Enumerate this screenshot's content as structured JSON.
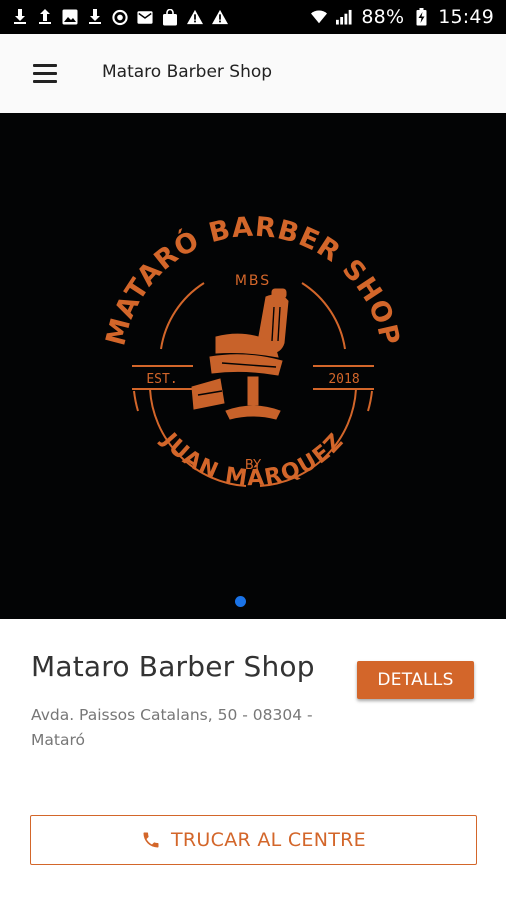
{
  "status_bar": {
    "left_icons": [
      "download-icon",
      "upload-icon",
      "image-icon",
      "download-icon",
      "sync-icon",
      "mail-icon",
      "bag-icon",
      "warning-icon",
      "warning-icon"
    ],
    "battery_percent": "88%",
    "time": "15:49"
  },
  "app_bar": {
    "title": "Mataro Barber Shop",
    "menu_icon": "hamburger-menu-icon"
  },
  "hero": {
    "logo": {
      "top_text": "MATARÓ BARBER SHOP",
      "initials": "MBS",
      "est_label": "EST.",
      "year": "2018",
      "by_label": "BY",
      "bottom_text": "JUAN MÁRQUEZ"
    },
    "carousel_pages": 1,
    "carousel_active": 1
  },
  "shop": {
    "name": "Mataro Barber Shop",
    "address": "Avda. Paissos Catalans, 50 - 08304 - Mataró",
    "details_label": "DETALLS",
    "call_label": "TRUCAR AL CENTRE",
    "call_icon": "phone-icon"
  },
  "colors": {
    "accent": "#d3662a",
    "hero_bg": "#030405",
    "carousel_dot": "#1a73e8",
    "status_bar": "#000000"
  }
}
